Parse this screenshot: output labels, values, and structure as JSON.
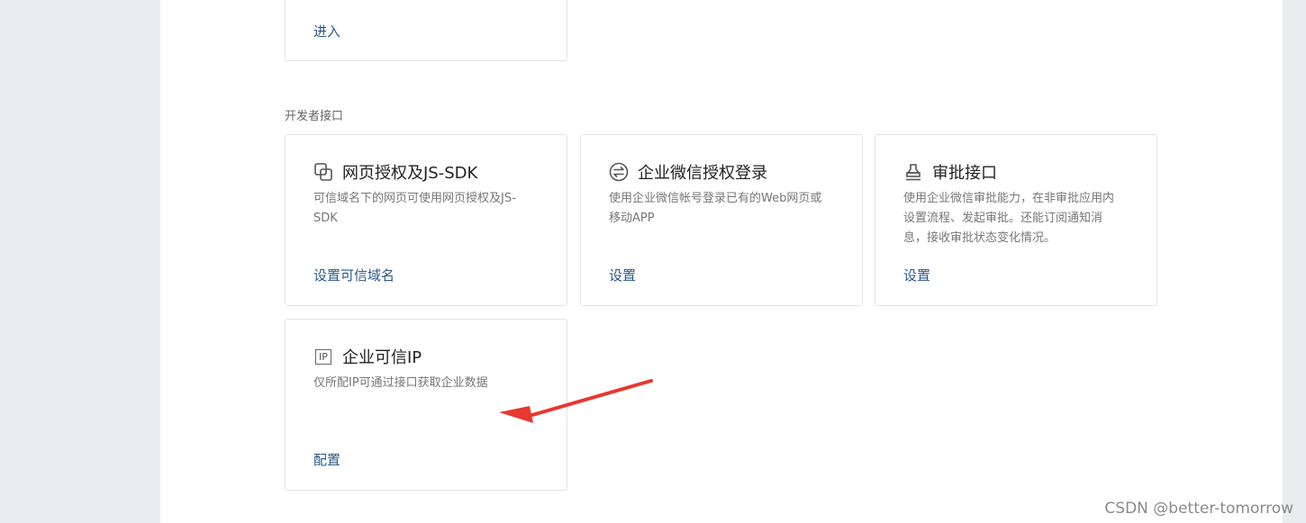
{
  "top_card": {
    "action": "进入"
  },
  "section_title": "开发者接口",
  "cards": [
    {
      "title": "网页授权及JS-SDK",
      "icon": "copy-icon",
      "desc_line1": "可信域名下的网页可使用网页授权及JS-",
      "desc_line2": "SDK",
      "action": "设置可信域名"
    },
    {
      "title": "企业微信授权登录",
      "icon": "exchange-icon",
      "desc_line1": "使用企业微信帐号登录已有的Web网页或",
      "desc_line2": "移动APP",
      "action": "设置"
    },
    {
      "title": "审批接口",
      "icon": "stamp-icon",
      "desc_line1": "使用企业微信审批能力，在非审批应用内",
      "desc_line2": "设置流程、发起审批。还能订阅通知消",
      "desc_line3": "息，接收审批状态变化情况。",
      "action": "设置"
    },
    {
      "title": "企业可信IP",
      "icon": "ip-icon",
      "icon_text": "IP",
      "desc_line1": "仅所配IP可通过接口获取企业数据",
      "action": "配置"
    }
  ],
  "watermark": "CSDN @better-tomorrow",
  "colors": {
    "link": "#2a5785",
    "arrow": "#e8382f",
    "border": "#e1e3e6"
  }
}
